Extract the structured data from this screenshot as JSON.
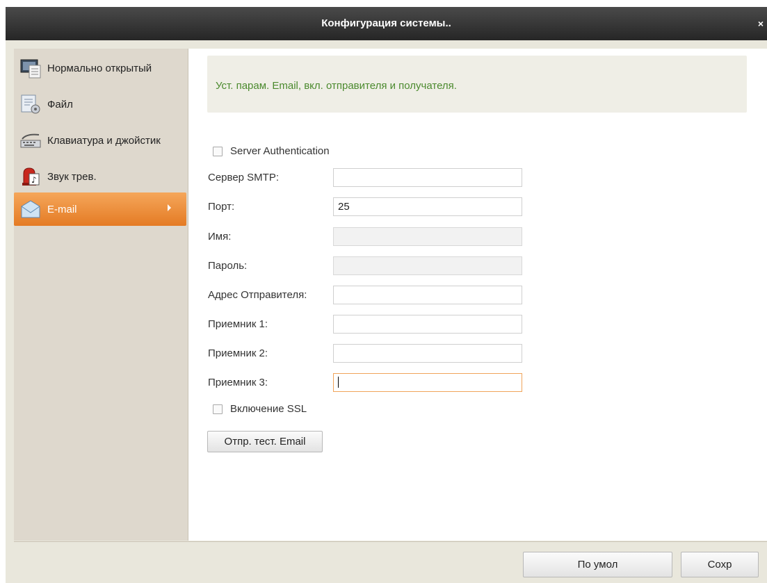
{
  "window": {
    "title": "Конфигурация системы..",
    "close_glyph": "×"
  },
  "sidebar": {
    "items": [
      {
        "label": "Нормально открытый",
        "icon": "monitor-icon"
      },
      {
        "label": "Файл",
        "icon": "file-settings-icon"
      },
      {
        "label": "Клавиатура и джойстик",
        "icon": "keyboard-icon"
      },
      {
        "label": "Звук трев.",
        "icon": "alarm-sound-icon"
      },
      {
        "label": "E-mail",
        "icon": "email-icon",
        "active": true
      }
    ]
  },
  "main": {
    "info_text": "Уст. парам. Email, вкл. отправителя и получателя.",
    "server_auth": {
      "label": "Server Authentication",
      "checked": false
    },
    "fields": {
      "smtp": {
        "label": "Сервер SMTP:",
        "value": ""
      },
      "port": {
        "label": "Порт:",
        "value": "25"
      },
      "name": {
        "label": "Имя:",
        "value": ""
      },
      "password": {
        "label": "Пароль:",
        "value": ""
      },
      "sender": {
        "label": "Адрес Отправителя:",
        "value": ""
      },
      "receiver1": {
        "label": "Приемник 1:",
        "value": ""
      },
      "receiver2": {
        "label": "Приемник 2:",
        "value": ""
      },
      "receiver3": {
        "label": "Приемник 3:",
        "value": ""
      }
    },
    "ssl": {
      "label": "Включение SSL",
      "checked": false
    },
    "test_button": "Отпр. тест. Email"
  },
  "footer": {
    "default_button": "По умол",
    "save_button": "Сохр"
  },
  "colors": {
    "accent": "#e47b24",
    "info_text": "#4b8a2e",
    "titlebar": "#262626"
  }
}
